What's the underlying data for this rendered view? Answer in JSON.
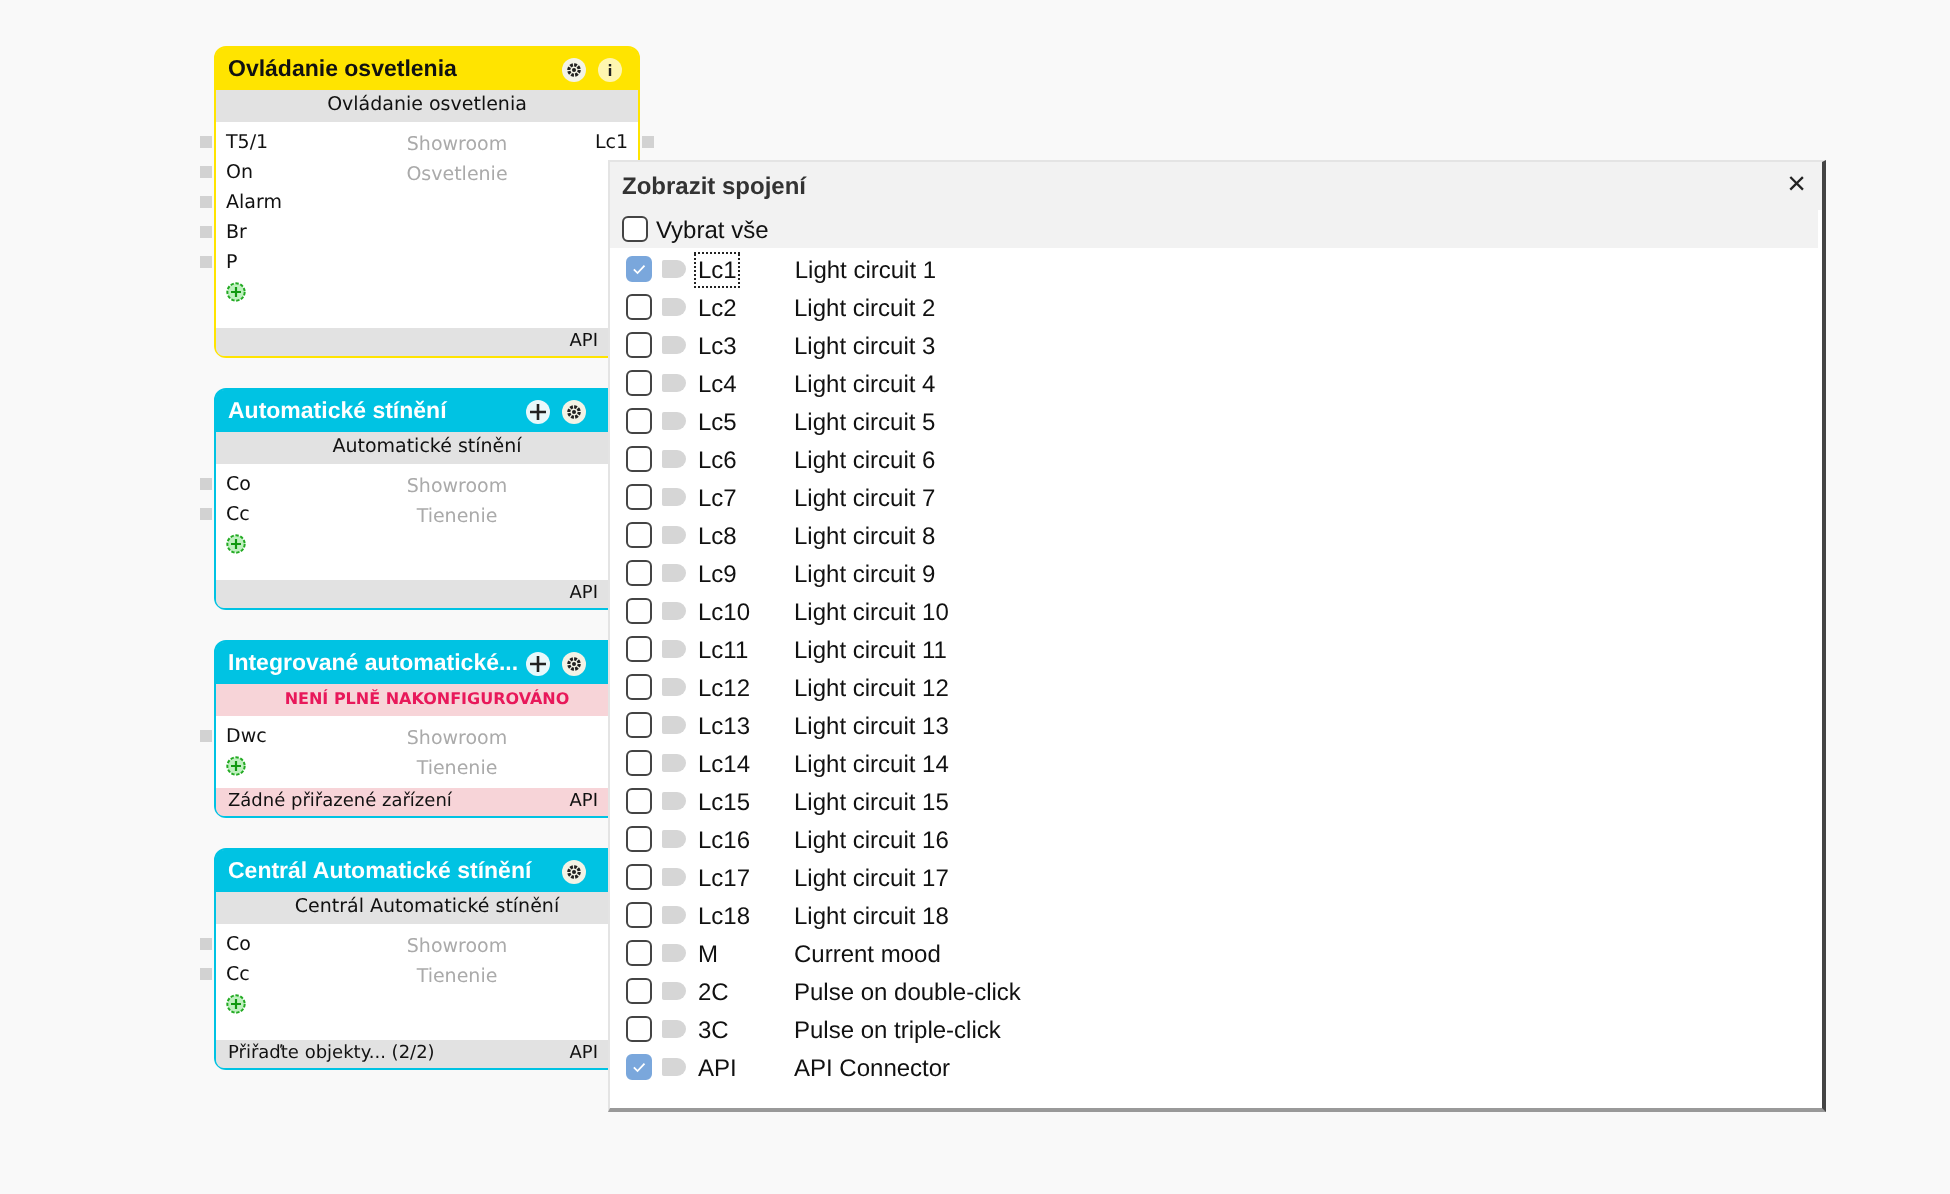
{
  "nodes": [
    {
      "title": "Ovládanie osvetlenia",
      "color": "#ffe400",
      "header_icons": [
        {
          "kind": "settings"
        },
        {
          "kind": "info"
        }
      ],
      "subtitle": "Ovládanie osvetlenia",
      "inputs": [
        "T5/1",
        "On",
        "Alarm",
        "Br",
        "P"
      ],
      "outputs": [
        "Lc1"
      ],
      "location": "Showroom",
      "category": "Osvetlenie",
      "footer_alert": false,
      "footer_right": "API"
    },
    {
      "title": "Automatické stínění",
      "color": "#00c3e3",
      "header_icons": [
        {
          "kind": "move"
        },
        {
          "kind": "settings"
        }
      ],
      "subtitle": "Automatické stínění",
      "inputs": [
        "Co",
        "Cc"
      ],
      "location": "Showroom",
      "category": "Tienenie",
      "footer_alert": false,
      "footer_right": "API"
    },
    {
      "title": "Integrované  automatické...",
      "color": "#00c3e3",
      "header_icons": [
        {
          "kind": "move"
        },
        {
          "kind": "settings"
        }
      ],
      "warning": "NENÍ PLNĚ NAKONFIGUROVÁNO",
      "inputs": [
        "Dwc"
      ],
      "location": "Showroom",
      "category": "Tienenie",
      "footer_left": "Zádné přiřazené zařízení",
      "footer_alert": true,
      "footer_right": "API"
    },
    {
      "title": "Centrál Automatické stínění",
      "color": "#00c3e3",
      "header_icons": [
        {
          "kind": "settings"
        }
      ],
      "subtitle": "Centrál Automatické stínění",
      "inputs": [
        "Co",
        "Cc"
      ],
      "location": "Showroom",
      "category": "Tienenie",
      "footer_left": "Přiřaďte objekty... (2/2)",
      "footer_alert": false,
      "footer_right": "API"
    }
  ],
  "dialog": {
    "title": "Zobrazit spojení",
    "close": "×",
    "select_all": {
      "label": "Vybrat vše",
      "checked": false
    },
    "items": [
      {
        "code": "Lc1",
        "name": "Light circuit 1",
        "checked": true,
        "focused": true
      },
      {
        "code": "Lc2",
        "name": "Light circuit 2",
        "checked": false,
        "focused": false
      },
      {
        "code": "Lc3",
        "name": "Light circuit 3",
        "checked": false,
        "focused": false
      },
      {
        "code": "Lc4",
        "name": "Light circuit 4",
        "checked": false,
        "focused": false
      },
      {
        "code": "Lc5",
        "name": "Light circuit 5",
        "checked": false,
        "focused": false
      },
      {
        "code": "Lc6",
        "name": "Light circuit 6",
        "checked": false,
        "focused": false
      },
      {
        "code": "Lc7",
        "name": "Light circuit 7",
        "checked": false,
        "focused": false
      },
      {
        "code": "Lc8",
        "name": "Light circuit 8",
        "checked": false,
        "focused": false
      },
      {
        "code": "Lc9",
        "name": "Light circuit 9",
        "checked": false,
        "focused": false
      },
      {
        "code": "Lc10",
        "name": "Light circuit 10",
        "checked": false,
        "focused": false
      },
      {
        "code": "Lc11",
        "name": "Light circuit 11",
        "checked": false,
        "focused": false
      },
      {
        "code": "Lc12",
        "name": "Light circuit 12",
        "checked": false,
        "focused": false
      },
      {
        "code": "Lc13",
        "name": "Light circuit 13",
        "checked": false,
        "focused": false
      },
      {
        "code": "Lc14",
        "name": "Light circuit 14",
        "checked": false,
        "focused": false
      },
      {
        "code": "Lc15",
        "name": "Light circuit 15",
        "checked": false,
        "focused": false
      },
      {
        "code": "Lc16",
        "name": "Light circuit 16",
        "checked": false,
        "focused": false
      },
      {
        "code": "Lc17",
        "name": "Light circuit 17",
        "checked": false,
        "focused": false
      },
      {
        "code": "Lc18",
        "name": "Light circuit 18",
        "checked": false,
        "focused": false
      },
      {
        "code": "M",
        "name": "Current mood",
        "checked": false,
        "focused": false
      },
      {
        "code": "2C",
        "name": "Pulse on double-click",
        "checked": false,
        "focused": false
      },
      {
        "code": "3C",
        "name": "Pulse on triple-click",
        "checked": false,
        "focused": false
      },
      {
        "code": "API",
        "name": "API Connector",
        "checked": true,
        "focused": false
      }
    ]
  }
}
